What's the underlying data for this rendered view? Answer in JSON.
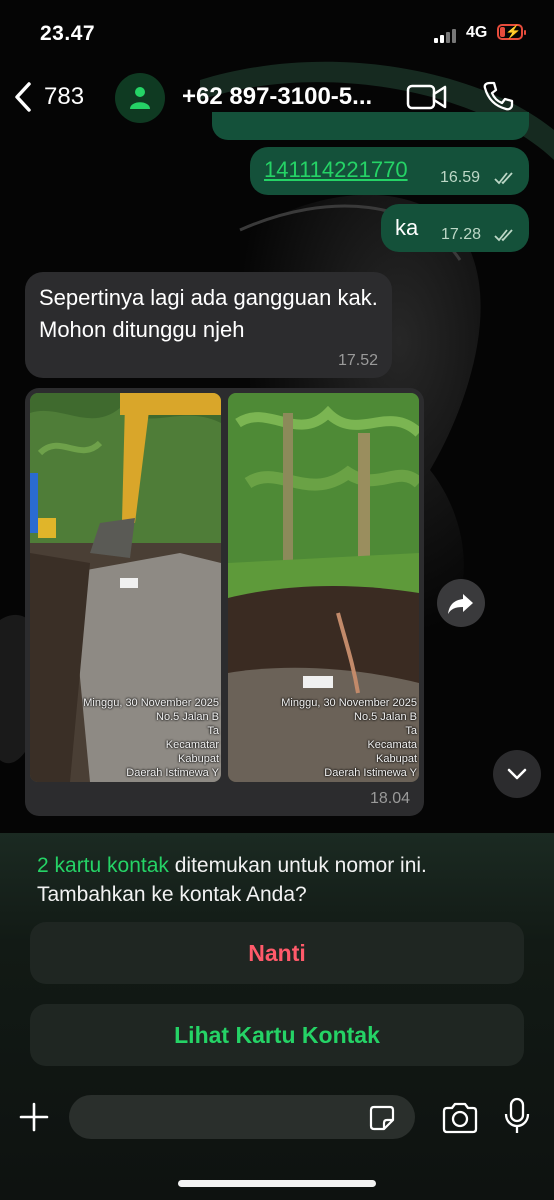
{
  "status": {
    "time": "23.47",
    "network": "4G"
  },
  "header": {
    "back_count": "783",
    "contact": "+62 897-3100-5..."
  },
  "messages": [
    {
      "text": "141114221770",
      "time": "16.59"
    },
    {
      "text": "ka",
      "time": "17.28"
    },
    {
      "text": "Sepertinya lagi ada gangguan kak. Mohon ditunggu njeh",
      "time": "17.52"
    },
    {
      "photos": [
        {
          "stamp": [
            "Minggu, 30 November 2025",
            "No.5 Jalan B",
            "Ta",
            "Kecamatar",
            "Kabupat",
            "Daerah Istimewa Y"
          ]
        },
        {
          "stamp": [
            "Minggu, 30 November 2025",
            "No.5 Jalan B",
            "Ta",
            "Kecamata",
            "Kabupat",
            "Daerah Istimewa Y"
          ]
        }
      ],
      "time": "18.04"
    }
  ],
  "contact_notice": {
    "highlight": "2 kartu kontak",
    "text": " ditemukan untuk nomor ini. Tambahkan ke kontak Anda?"
  },
  "buttons": {
    "later": "Nanti",
    "view": "Lihat Kartu Kontak"
  },
  "colors": {
    "accent": "#25d366",
    "outgoing_bubble": "#14513a",
    "incoming_bubble": "#2c2c2e",
    "danger": "#ff5a6a"
  }
}
